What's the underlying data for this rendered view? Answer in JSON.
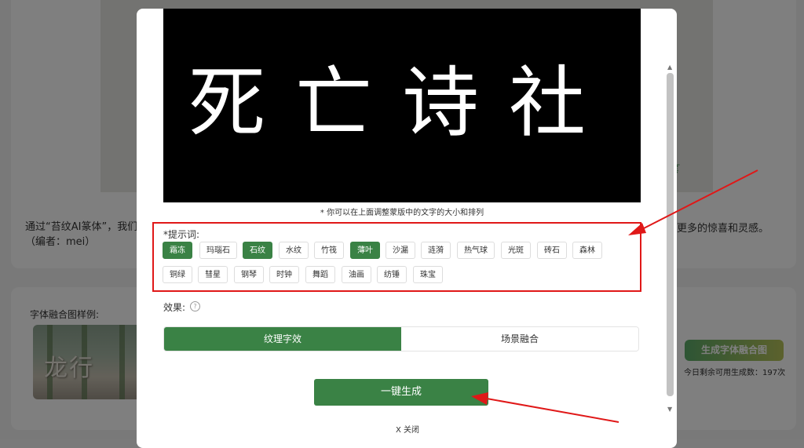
{
  "background": {
    "watermark_text": "笔",
    "description": "通过“苔纹AI篆体”，我们将（编者：mei）",
    "description_right": "更多的惊喜和灵感。",
    "examples_title": "字体融合图样例:",
    "example_image_text": "龙行",
    "generate_fusion_label": "生成字体融合图",
    "remaining_text": "今日剩余可用生成数：197次"
  },
  "modal": {
    "preview_text": "死亡诗社",
    "mask_hint": "* 你可以在上面调整蒙版中的文字的大小和排列",
    "prompt_label": "*提示词:",
    "tags": [
      {
        "label": "霜冻",
        "active": true
      },
      {
        "label": "玛瑙石",
        "active": false
      },
      {
        "label": "石纹",
        "active": true
      },
      {
        "label": "水纹",
        "active": false
      },
      {
        "label": "竹筏",
        "active": false
      },
      {
        "label": "薄叶",
        "active": true
      },
      {
        "label": "沙漏",
        "active": false
      },
      {
        "label": "涟漪",
        "active": false
      },
      {
        "label": "热气球",
        "active": false
      },
      {
        "label": "光斑",
        "active": false
      },
      {
        "label": "砖石",
        "active": false
      },
      {
        "label": "森林",
        "active": false
      },
      {
        "label": "铜绿",
        "active": false
      },
      {
        "label": "彗星",
        "active": false
      },
      {
        "label": "钢琴",
        "active": false
      },
      {
        "label": "时钟",
        "active": false
      },
      {
        "label": "舞蹈",
        "active": false
      },
      {
        "label": "油画",
        "active": false
      },
      {
        "label": "纺锤",
        "active": false
      },
      {
        "label": "珠宝",
        "active": false
      }
    ],
    "effect_label": "效果:",
    "help_icon": "?",
    "effect_options": [
      "纹理字效",
      "场景融合"
    ],
    "selected_effect": "纹理字效",
    "generate_label": "一键生成",
    "close_label": "X 关闭"
  },
  "colors": {
    "accent_green": "#3a8245",
    "annotation_red": "#e01818"
  }
}
